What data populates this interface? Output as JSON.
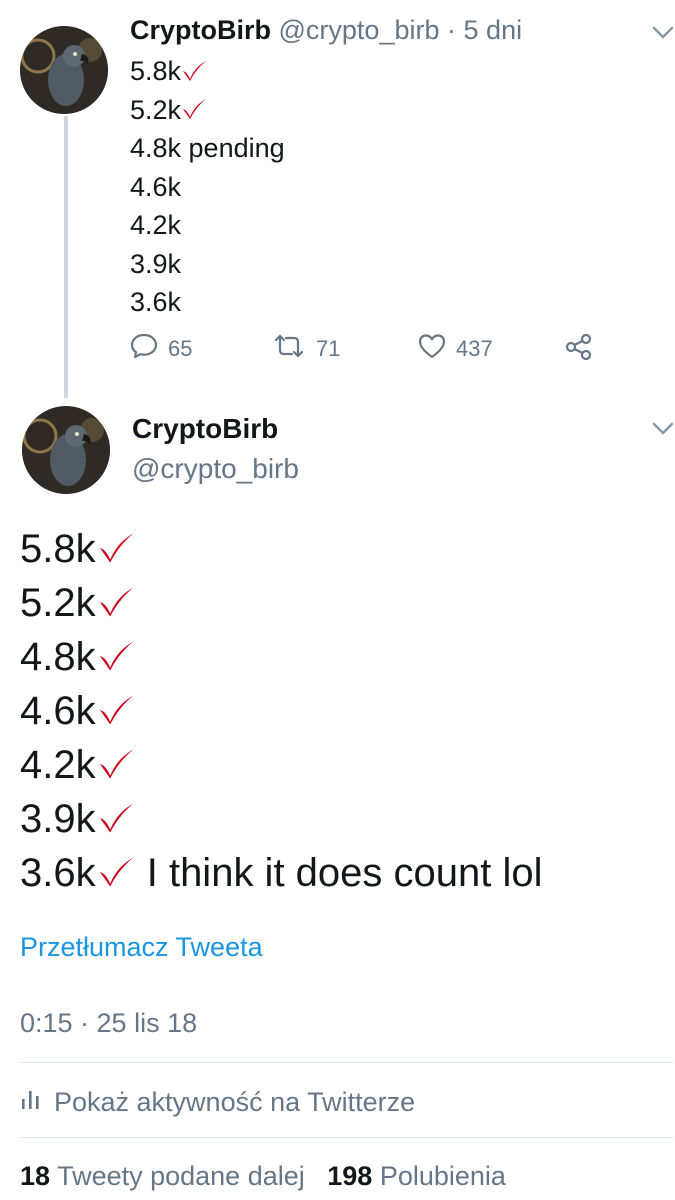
{
  "tweet1": {
    "name": "CryptoBirb",
    "handle": "@crypto_birb",
    "separator": "·",
    "time": "5 dni",
    "lines": [
      {
        "text": "5.8k",
        "checked": true
      },
      {
        "text": "5.2k",
        "checked": true
      },
      {
        "text": "4.8k pending",
        "checked": false
      },
      {
        "text": "4.6k",
        "checked": false
      },
      {
        "text": "4.2k",
        "checked": false
      },
      {
        "text": "3.9k",
        "checked": false
      },
      {
        "text": "3.6k",
        "checked": false
      }
    ],
    "replies": "65",
    "retweets": "71",
    "likes": "437"
  },
  "tweet2": {
    "name": "CryptoBirb",
    "handle": "@crypto_birb",
    "lines": [
      {
        "text": "5.8k",
        "suffix": ""
      },
      {
        "text": "5.2k",
        "suffix": ""
      },
      {
        "text": "4.8k",
        "suffix": ""
      },
      {
        "text": "4.6k",
        "suffix": ""
      },
      {
        "text": "4.2k",
        "suffix": ""
      },
      {
        "text": "3.9k",
        "suffix": ""
      },
      {
        "text": "3.6k",
        "suffix": " I think it does count lol"
      }
    ],
    "translate": "Przetłumacz Tweeta",
    "timestamp": "0:15 · 25 lis 18",
    "activity": "Pokaż aktywność na Twitterze",
    "retweet_count": "18",
    "retweet_label": "Tweety podane dalej",
    "like_count": "198",
    "like_label": "Polubienia"
  },
  "colors": {
    "link": "#1b95e0",
    "check": "#d0021b",
    "muted": "#657786"
  },
  "icons": [
    "chevron-down-icon",
    "check-mark-icon",
    "reply-icon",
    "retweet-icon",
    "like-icon",
    "share-icon",
    "activity-icon",
    "avatar"
  ]
}
